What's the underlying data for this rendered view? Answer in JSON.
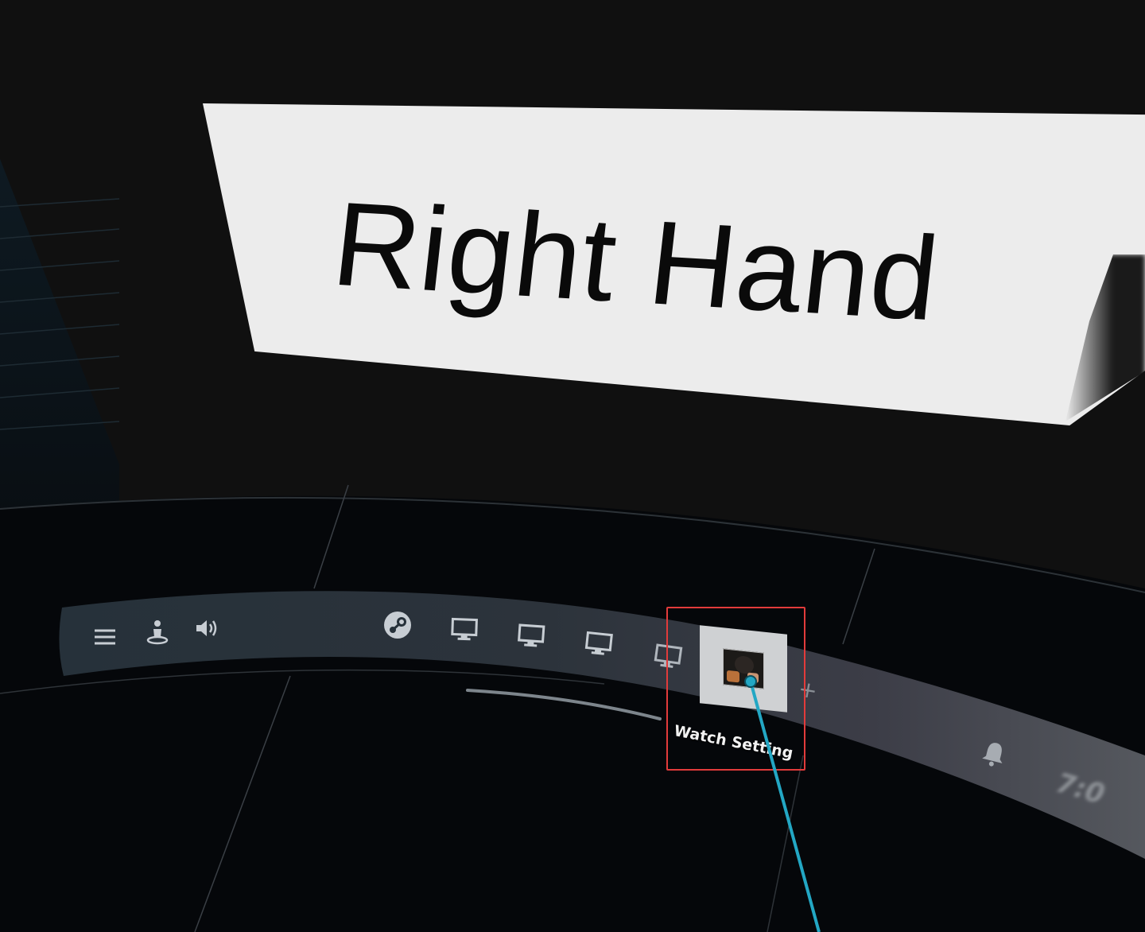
{
  "title_card": {
    "label": "Right Hand"
  },
  "dock": {
    "left_icons": [
      {
        "name": "menu-icon"
      },
      {
        "name": "person-icon"
      },
      {
        "name": "volume-icon"
      }
    ],
    "center_icons": [
      {
        "name": "steam-icon"
      },
      {
        "name": "monitor-icon"
      },
      {
        "name": "monitor-icon"
      },
      {
        "name": "monitor-icon"
      },
      {
        "name": "monitor-icon"
      }
    ],
    "selected_item": {
      "tooltip": "Watch Setting",
      "icon": "thumbnail-image"
    },
    "add_icon": "+",
    "right_icons": [
      {
        "name": "bell-icon"
      }
    ],
    "clock": "7:0"
  },
  "colors": {
    "highlight": "#e23b3b",
    "pointer": "#23a7c4",
    "card": "#ececec"
  }
}
